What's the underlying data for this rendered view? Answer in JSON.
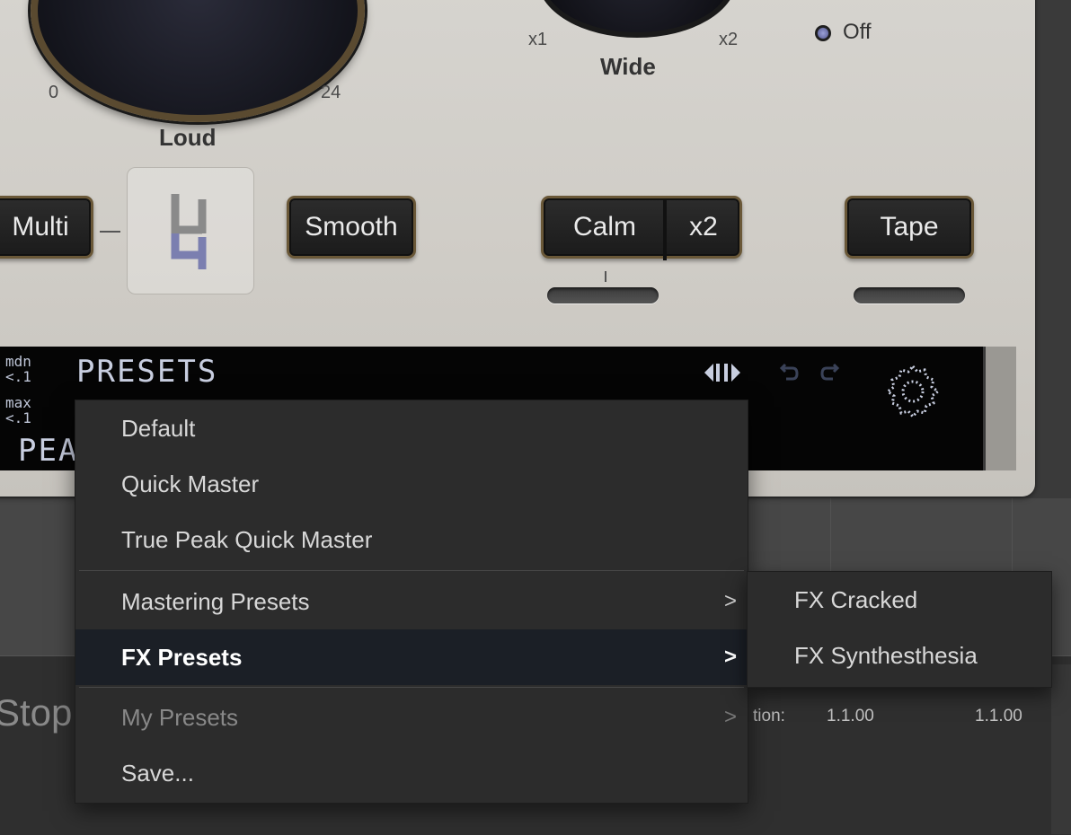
{
  "plugin": {
    "knobs": {
      "loud": {
        "label": "Loud",
        "scale_min": "0",
        "scale_max": "24"
      },
      "wide": {
        "label": "Wide",
        "scale_min": "x1",
        "scale_max": "x2"
      }
    },
    "radio": {
      "off_label": "Off"
    },
    "buttons": {
      "multi": "Multi",
      "smooth": "Smooth",
      "calm": "Calm",
      "x2": "x2",
      "tape": "Tape"
    },
    "lcd": {
      "mdn_label": "mdn",
      "mdn_value": "<.1",
      "max_label": "max",
      "max_value": "<.1",
      "title": "PRESETS",
      "big_text": "PEA"
    }
  },
  "menu": {
    "items": [
      {
        "label": "Default"
      },
      {
        "label": "Quick Master"
      },
      {
        "label": "True Peak Quick Master"
      },
      {
        "label": "Mastering Presets",
        "submenu": true
      },
      {
        "label": "FX Presets",
        "submenu": true,
        "active": true
      },
      {
        "label": "My Presets",
        "submenu": true,
        "disabled": true
      },
      {
        "label": "Save..."
      }
    ],
    "submenu_items": [
      {
        "label": "FX Cracked"
      },
      {
        "label": "FX Synthesthesia"
      }
    ],
    "chevron": ">"
  },
  "host": {
    "status_text": "Stopp",
    "version_label": "tion:",
    "version_a": "1.1.00",
    "version_b": "1.1.00"
  },
  "icons": {
    "logo": "plugin-logo-icon",
    "nav": "prev-next-arrows-icon",
    "undo": "undo-icon",
    "redo": "redo-icon",
    "settings": "gear-icon"
  }
}
